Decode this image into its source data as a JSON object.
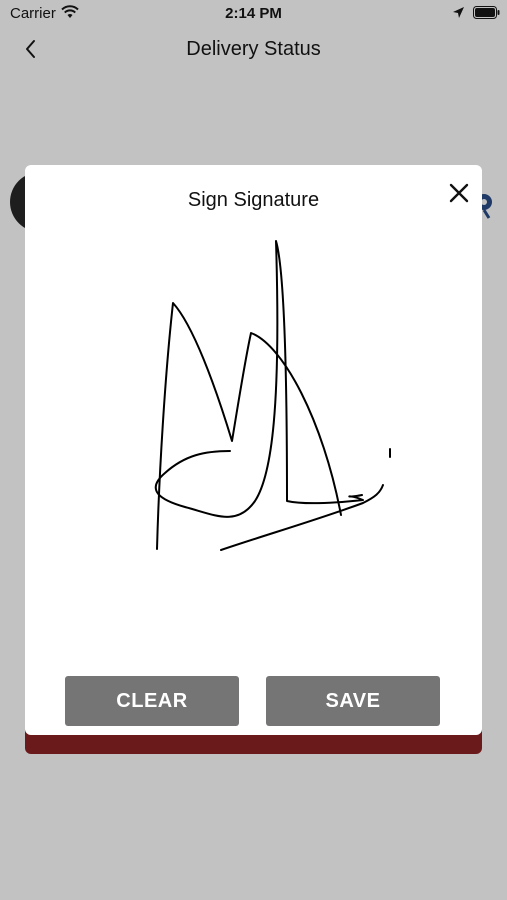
{
  "status_bar": {
    "carrier": "Carrier",
    "time": "2:14 PM"
  },
  "nav": {
    "title": "Delivery Status"
  },
  "modal": {
    "title": "Sign Signature",
    "clear_label": "CLEAR",
    "save_label": "SAVE"
  },
  "colors": {
    "background": "#c2c2c2",
    "button": "#757575",
    "accent_bar": "#6b1a1c"
  }
}
